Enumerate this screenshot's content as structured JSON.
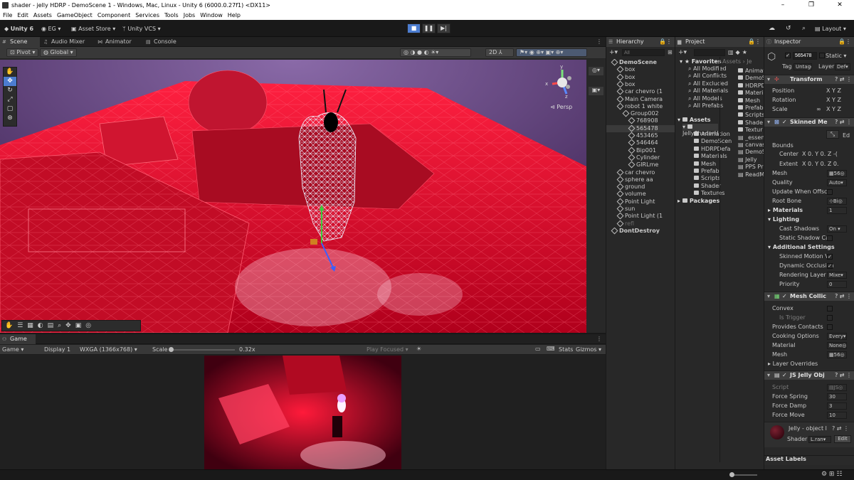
{
  "window": {
    "title": "shader - jelly HDRP - DemoScene 1 - Windows, Mac, Linux - Unity 6 (6000.0.27f1) <DX11>",
    "minimize": "–",
    "maximize": "❐",
    "close": "✕"
  },
  "menu": [
    "File",
    "Edit",
    "Assets",
    "GameObject",
    "Component",
    "Services",
    "Tools",
    "Jobs",
    "Window",
    "Help"
  ],
  "toolbar": {
    "account": "Unity 6",
    "user": "EG",
    "asset_store": "Asset Store",
    "vcs": "Unity VCS",
    "layout": "Layout"
  },
  "tabs_left": {
    "scene": "Scene",
    "audio_mixer": "Audio Mixer",
    "animator": "Animator",
    "console": "Console"
  },
  "scene": {
    "pivot": "Pivot",
    "global": "Global",
    "persp": "Persp",
    "gizmo_y": "y",
    "gizmo_x": "x",
    "gizmo_z": "z"
  },
  "game": {
    "tab": "Game",
    "mode": "Game",
    "display": "Display 1",
    "resolution": "WXGA (1366x768)",
    "scale_label": "Scale",
    "scale_value": "0.32x",
    "play_focused": "Play Focused",
    "stats": "Stats",
    "gizmos": "Gizmos"
  },
  "hierarchy": {
    "title": "Hierarchy",
    "search_placeholder": "All",
    "rows": [
      {
        "label": "DemoScene",
        "indent": 0,
        "bold": true,
        "icon": "scene"
      },
      {
        "label": "box",
        "indent": 1
      },
      {
        "label": "box",
        "indent": 1
      },
      {
        "label": "box",
        "indent": 1
      },
      {
        "label": "car chevro (1",
        "indent": 1
      },
      {
        "label": "Main Camera",
        "indent": 1
      },
      {
        "label": "robot 1 white",
        "indent": 1
      },
      {
        "label": "Group002",
        "indent": 2
      },
      {
        "label": "768908",
        "indent": 3
      },
      {
        "label": "565478",
        "indent": 3,
        "selected": true
      },
      {
        "label": "453465",
        "indent": 3
      },
      {
        "label": "546464",
        "indent": 3
      },
      {
        "label": "Bip001",
        "indent": 3
      },
      {
        "label": "Cylinder",
        "indent": 3
      },
      {
        "label": "GIRLme",
        "indent": 3
      },
      {
        "label": "car chevro",
        "indent": 1
      },
      {
        "label": "sphere aa",
        "indent": 1
      },
      {
        "label": "ground",
        "indent": 1
      },
      {
        "label": "volume",
        "indent": 1
      },
      {
        "label": "Point Light",
        "indent": 1
      },
      {
        "label": "sun",
        "indent": 1
      },
      {
        "label": "Point Light (1",
        "indent": 1
      },
      {
        "label": "refl",
        "indent": 1,
        "dim": true
      },
      {
        "label": "DontDestroy",
        "indent": 0,
        "bold": true,
        "icon": "scene"
      }
    ]
  },
  "project": {
    "title": "Project",
    "favorites": "Favorites",
    "fav_items": [
      "All Modified",
      "All Conflicts",
      "All Excluded",
      "All Materials",
      "All Models",
      "All Prefabs"
    ],
    "assets": "Assets",
    "folder": "JellyShaderH",
    "folder_items": [
      "Animation",
      "DemoScen",
      "HDRPDefa",
      "Materials",
      "Mesh",
      "Prefab",
      "Scripts",
      "Shader",
      "Textures"
    ],
    "packages": "Packages",
    "breadcrumb": "Assets › Je",
    "right_items": [
      "Animat",
      "DemoS",
      "HDRPD",
      "Materi",
      "Mesh",
      "Prefab",
      "Scripts",
      "Shade",
      "Textur",
      "_essen",
      "canvas",
      "DemoS",
      "Jelly",
      "PPS Pr",
      "ReadM"
    ]
  },
  "inspector": {
    "title": "Inspector",
    "object_name": "565478",
    "static": "Static",
    "tag_label": "Tag",
    "tag_value": "Untagg",
    "layer_label": "Layer",
    "layer_value": "Def",
    "transform": {
      "title": "Transform",
      "position": "Position",
      "rotation": "Rotation",
      "scale": "Scale",
      "x": "X",
      "y": "Y",
      "z": "Z"
    },
    "skinned": {
      "title": "Skinned Me",
      "edit": "Ed",
      "bounds": "Bounds",
      "center": "Center",
      "extent": "Extent",
      "cx": "0.",
      "cy": "0.",
      "cz": "-(",
      "ex": "0.",
      "ey": "0.",
      "ez": "0.",
      "mesh": "Mesh",
      "mesh_value": "56",
      "quality": "Quality",
      "quality_value": "Auto",
      "update_offscreen": "Update When Offscre",
      "root_bone": "Root Bone",
      "root_bone_value": "Bi",
      "materials": "Materials",
      "materials_value": "1",
      "lighting": "Lighting",
      "cast_shadows": "Cast Shadows",
      "cast_shadows_value": "On",
      "static_caster": "Static Shadow Cas",
      "additional": "Additional Settings",
      "skinned_motion": "Skinned Motion Ve",
      "dynamic_occlusion": "Dynamic Occlusion",
      "rendering_layer": "Rendering Layer M",
      "rendering_layer_value": "Mixe",
      "priority": "Priority",
      "priority_value": "0"
    },
    "collider": {
      "title": "Mesh Collic",
      "convex": "Convex",
      "is_trigger": "Is Trigger",
      "provides_contacts": "Provides Contacts",
      "cooking": "Cooking Options",
      "cooking_value": "Every",
      "material": "Material",
      "material_value": "None",
      "mesh": "Mesh",
      "mesh_value": "56"
    },
    "layer_overrides": "Layer Overrides",
    "script": {
      "title": "JS Jelly Obj",
      "script_label": "Script",
      "script_value": "JS",
      "force_spring": "Force Spring",
      "force_spring_value": "30",
      "force_damp": "Force Damp",
      "force_damp_value": "3",
      "force_move": "Force Move",
      "force_move_value": "10"
    },
    "material": {
      "name": "Jelly - object l",
      "shader_label": "Shader",
      "shader_value": "L.ran",
      "edit": "Edit"
    },
    "asset_labels": "Asset Labels"
  },
  "colors": {
    "accent": "#4c7dd0",
    "bg": "#282828",
    "scene_red": "#e0102a",
    "sky": "#5a3a78"
  }
}
